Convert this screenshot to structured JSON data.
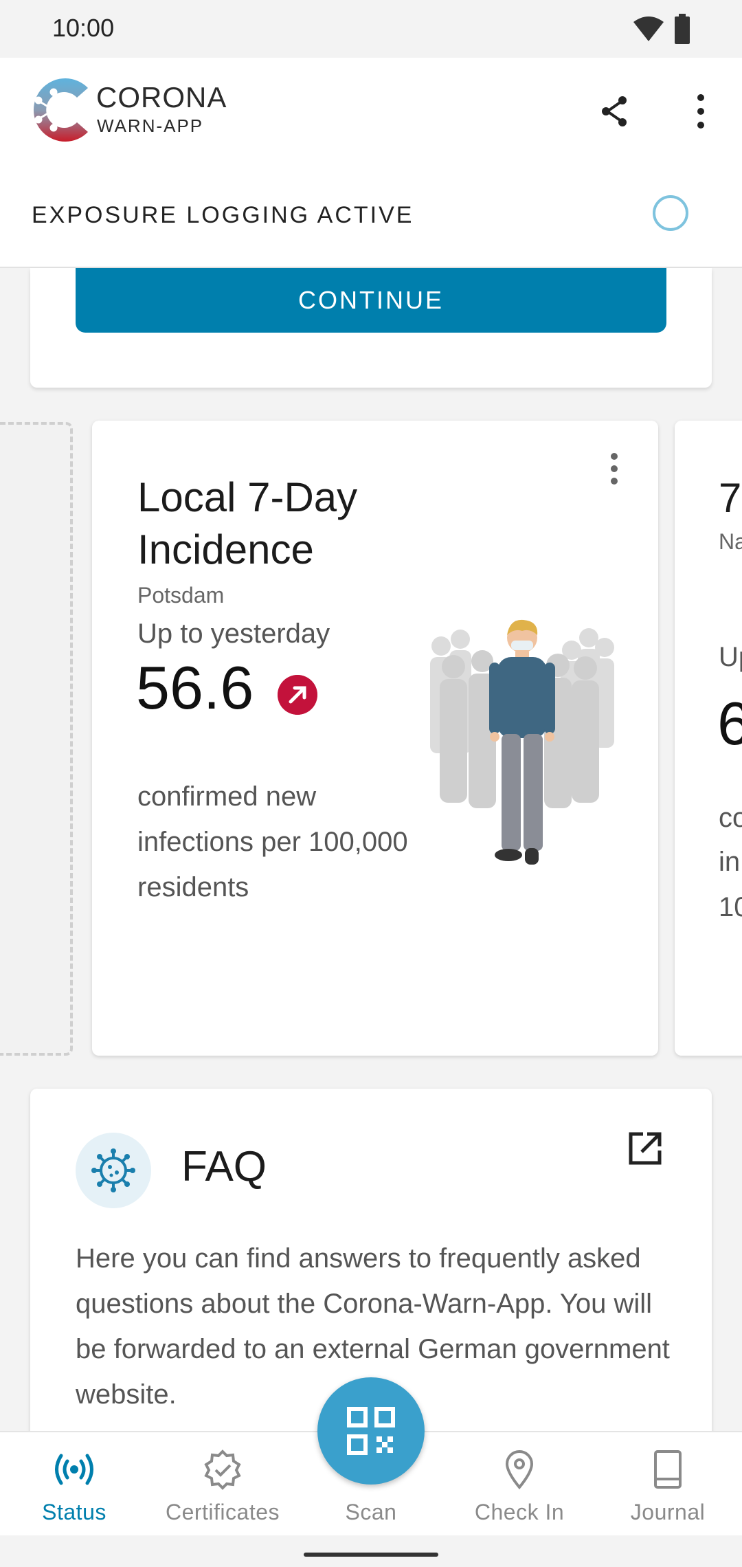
{
  "status_bar": {
    "time": "10:00"
  },
  "header": {
    "logo_title": "CORONA",
    "logo_subtitle": "WARN-APP",
    "share_icon": "share-icon",
    "menu_icon": "more-vert-icon",
    "exposure_status": "EXPOSURE LOGGING ACTIVE"
  },
  "continue_card": {
    "button_label": "CONTINUE"
  },
  "statistics": {
    "local_card": {
      "title": "Local 7-Day Incidence",
      "region": "Potsdam",
      "period": "Up to yesterday",
      "value": "56.6",
      "trend": "increasing",
      "description": "confirmed new infections per 100,000 residents"
    },
    "next_card": {
      "title_fragment": "7",
      "subtitle_fragment": "Na",
      "period_fragment": "Up",
      "value_fragment": "6",
      "desc_line1_fragment": "co",
      "desc_line2_fragment": "in",
      "desc_line3_fragment": "10"
    }
  },
  "faq": {
    "title": "FAQ",
    "icon": "virus-icon",
    "external_icon": "open-in-new-icon",
    "text": "Here you can find answers to frequently asked questions about the Corona-Warn-App. You will be forwarded to an external German government website."
  },
  "bottom_nav": {
    "items": [
      {
        "label": "Status",
        "icon": "status-broadcast-icon",
        "active": true
      },
      {
        "label": "Certificates",
        "icon": "certificate-check-icon",
        "active": false
      },
      {
        "label": "Scan",
        "icon": "qr-code-icon",
        "active": false
      },
      {
        "label": "Check In",
        "icon": "location-pin-icon",
        "active": false
      },
      {
        "label": "Journal",
        "icon": "book-icon",
        "active": false
      }
    ]
  },
  "colors": {
    "accent": "#007fad",
    "fab": "#3aa0cc",
    "trend_red": "#c3123b",
    "ring": "#7ec3de"
  }
}
